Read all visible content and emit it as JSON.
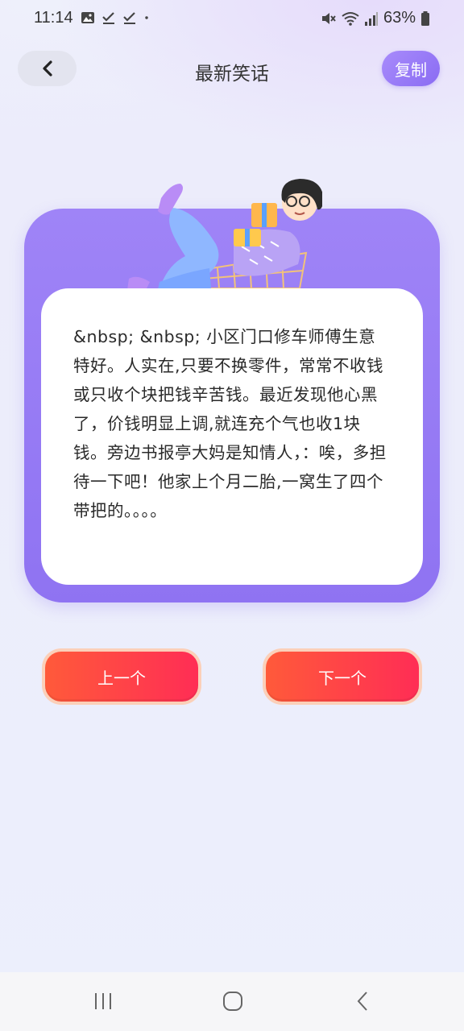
{
  "status_bar": {
    "time": "11:14",
    "battery": "63%"
  },
  "header": {
    "title": "最新笑话",
    "copy_label": "复制"
  },
  "joke": {
    "text": "&nbsp; &nbsp; 小区门口修车师傅生意特好。人实在,只要不换零件，常常不收钱或只收个块把钱辛苦钱。最近发现他心黑了，价钱明显上调,就连充个气也收1块钱。旁边书报亭大妈是知情人，：唉，多担待一下吧！他家上个月二胎,一窝生了四个带把的。。。。"
  },
  "buttons": {
    "prev_label": "上一个",
    "next_label": "下一个"
  },
  "colors": {
    "accent_purple": "#8f73f2",
    "button_red": "#ff3d45"
  }
}
